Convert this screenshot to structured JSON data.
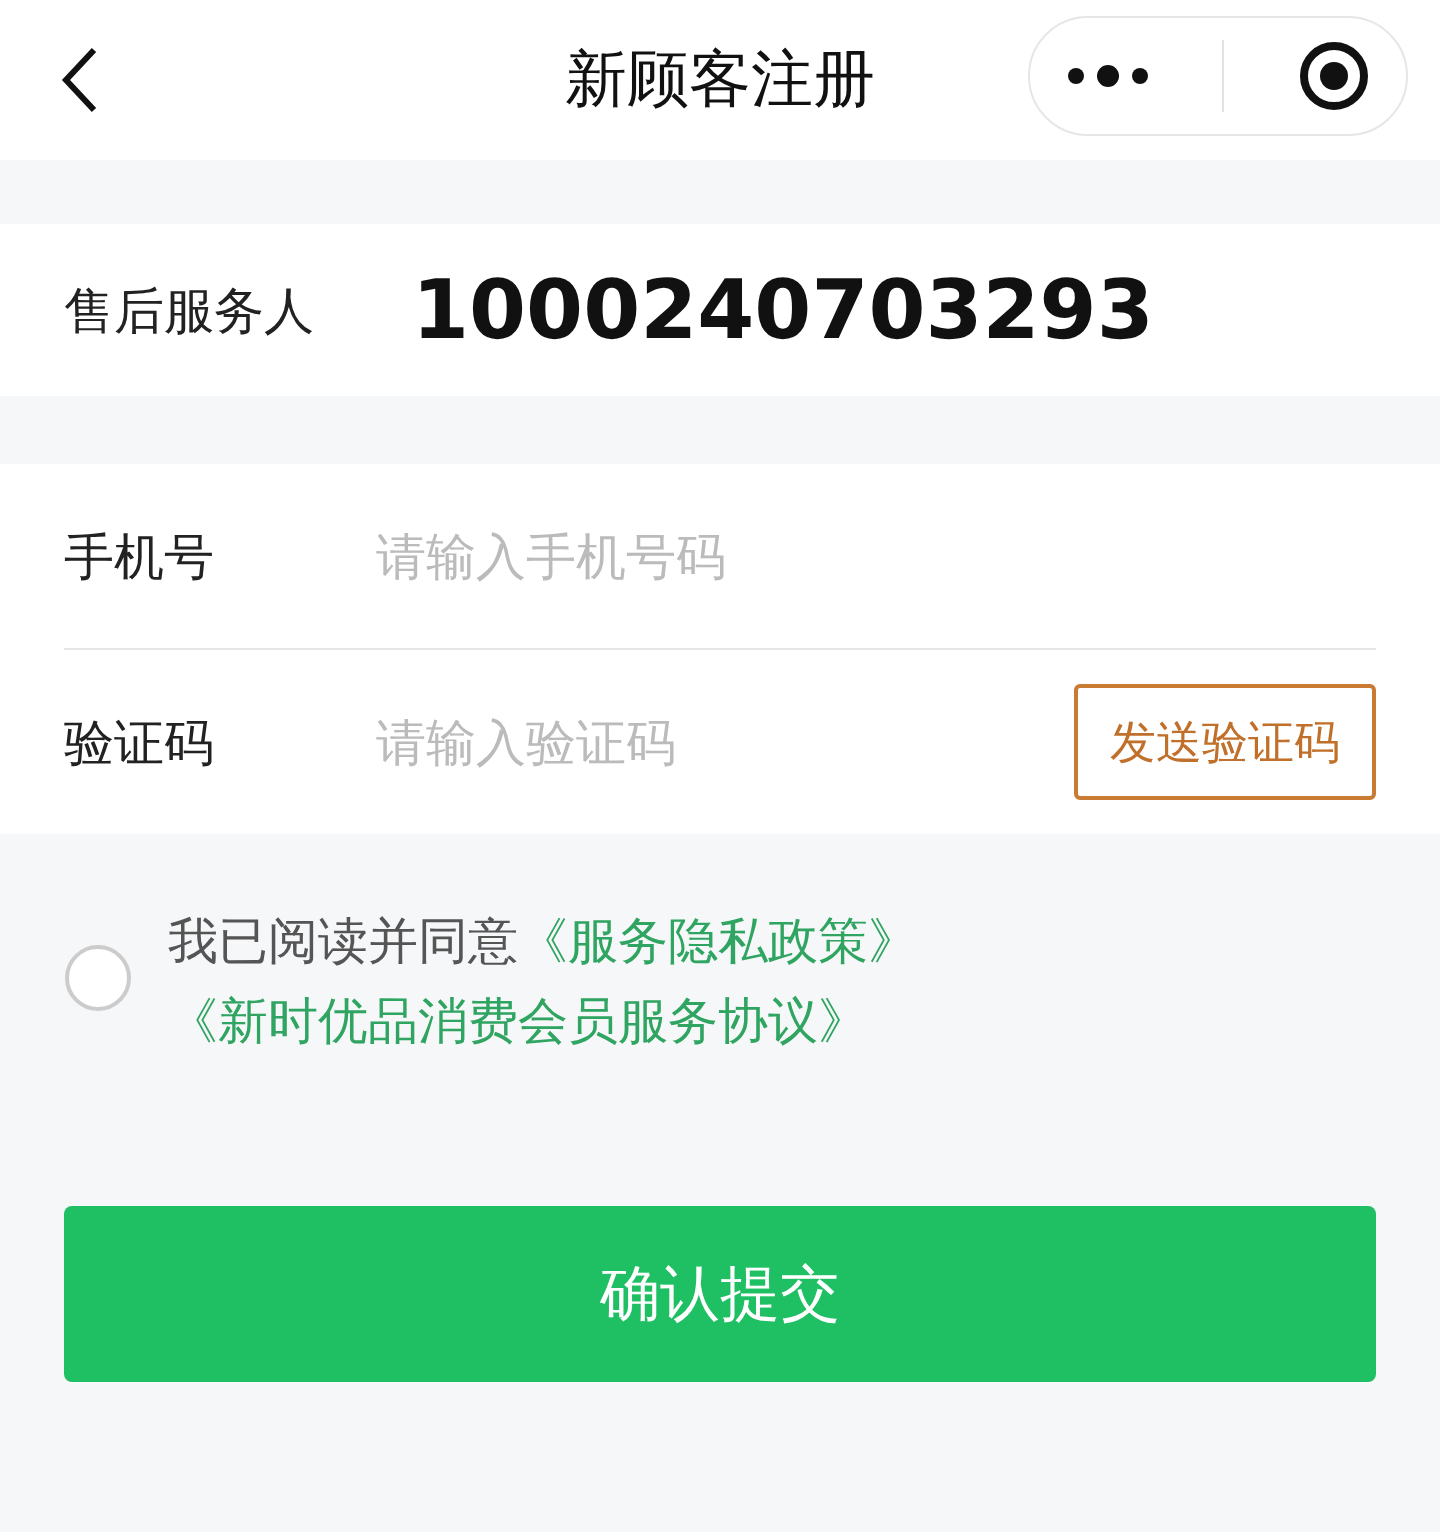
{
  "header": {
    "title": "新顾客注册"
  },
  "sections": [
    {
      "fields": [
        {
          "label": "售后服务人",
          "value": "1000240703293"
        }
      ]
    },
    {
      "fields": [
        {
          "label": "手机号",
          "placeholder": "请输入手机号码"
        },
        {
          "label": "验证码",
          "placeholder": "请输入验证码",
          "action": "发送验证码"
        }
      ]
    }
  ],
  "agreement": {
    "checked": false,
    "text": "我已阅读并同意",
    "links": [
      "《服务隐私政策》",
      "《新时优品消费会员服务协议》"
    ]
  },
  "submit": "确认提交"
}
